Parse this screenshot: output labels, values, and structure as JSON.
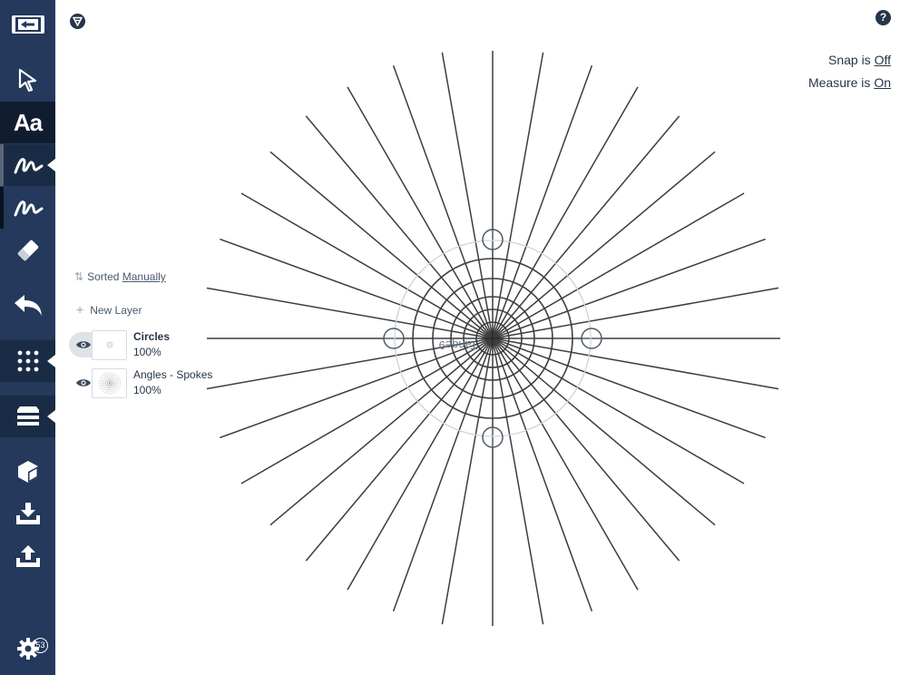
{
  "sidebar": {
    "tools": [
      {
        "name": "back",
        "icon": "back-arrow-icon"
      },
      {
        "name": "select",
        "icon": "pointer-arrow-icon"
      },
      {
        "name": "text",
        "icon": "text-tool-icon",
        "label": "Aa"
      },
      {
        "name": "pen",
        "icon": "pen-stroke-icon"
      },
      {
        "name": "brush",
        "icon": "brush-stroke-icon"
      },
      {
        "name": "eraser",
        "icon": "eraser-icon"
      },
      {
        "name": "undo",
        "icon": "undo-icon"
      },
      {
        "name": "grid",
        "icon": "grid-icon"
      },
      {
        "name": "layers",
        "icon": "layers-icon"
      },
      {
        "name": "shape",
        "icon": "shape-cube-icon"
      },
      {
        "name": "import",
        "icon": "download-tray-icon"
      },
      {
        "name": "export",
        "icon": "upload-tray-icon"
      },
      {
        "name": "settings",
        "icon": "gear-icon"
      }
    ],
    "settings_badge": "53"
  },
  "status": {
    "snap_label": "Snap is",
    "snap_value": "Off",
    "measure_label": "Measure is",
    "measure_value": "On"
  },
  "layers_panel": {
    "sort_label": "Sorted",
    "sort_value": "Manually",
    "new_layer_label": "New Layer",
    "layers": [
      {
        "name": "Circles",
        "opacity": "100%",
        "selected": true
      },
      {
        "name": "Angles - Spokes",
        "opacity": "100%",
        "selected": false
      }
    ]
  },
  "canvas": {
    "mirrored_label": "Tanqe9"
  },
  "colors": {
    "sidebar": "#24395b",
    "drawing_stroke": "#3d3d3d",
    "guide": "#cfcfcf",
    "handle": "#4a5a6c"
  }
}
